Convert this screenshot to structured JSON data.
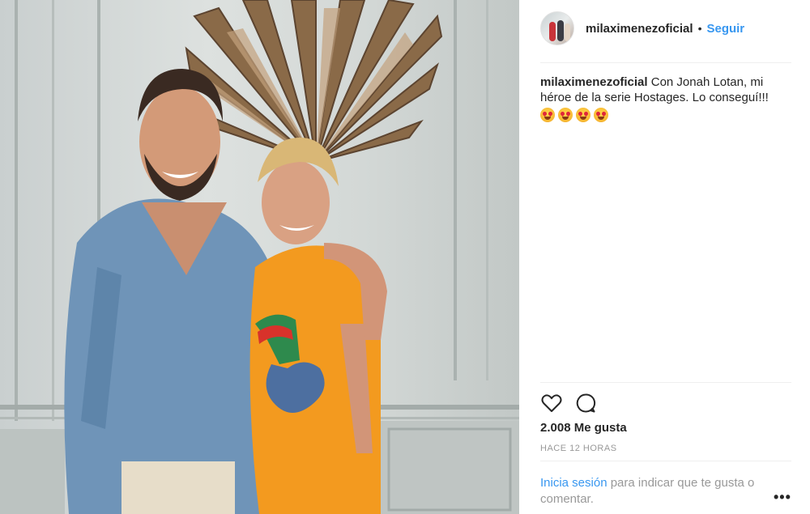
{
  "post": {
    "photo_alt_icon": "post-photo",
    "header": {
      "username": "milaximenezoficial",
      "separator": "•",
      "follow_label": "Seguir"
    },
    "caption": {
      "username": "milaximenezoficial",
      "text": "Con Jonah Lotan, mi héroe de la serie Hostages. Lo conseguí!!!",
      "emoji_name": "heart-eyes-emoji",
      "emoji_count": 4
    },
    "actions": {
      "like_icon": "heart-outline-icon",
      "comment_icon": "speech-bubble-icon"
    },
    "likes_text": "2.008 Me gusta",
    "timestamp": "HACE 12 HORAS",
    "login": {
      "link_label": "Inicia sesión",
      "rest": " para indicar que te gusta o comentar."
    },
    "more_label": "•••"
  },
  "colors": {
    "link": "#3897f0",
    "text": "#262626",
    "muted": "#999999",
    "divider": "#efefef"
  }
}
